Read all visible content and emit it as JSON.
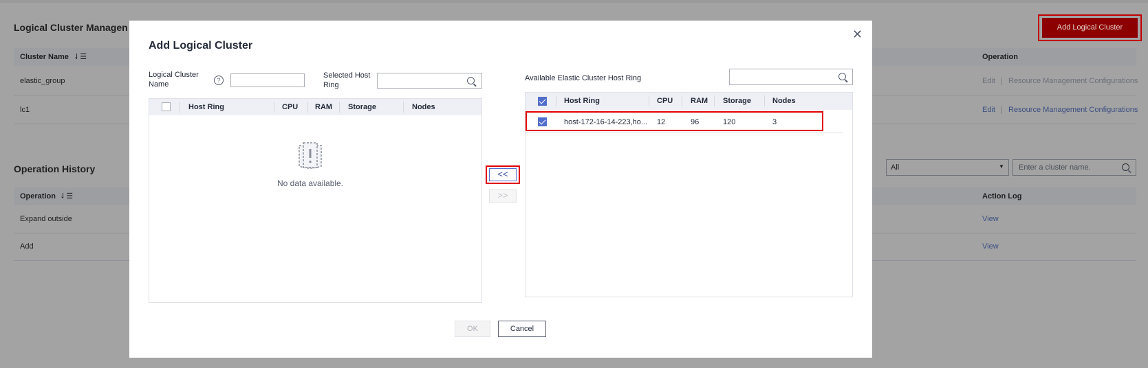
{
  "background": {
    "section1_title": "Logical Cluster Managen",
    "add_button_label": "Add Logical Cluster",
    "table1": {
      "col_cluster_name": "Cluster Name",
      "col_operation": "Operation",
      "rows": [
        {
          "name": "elastic_group",
          "edit": "Edit",
          "rmc": "Resource Management Configurations"
        },
        {
          "name": "lc1",
          "edit": "Edit",
          "rmc": "Resource Management Configurations"
        }
      ]
    },
    "section2_title": "Operation History",
    "filter_select": "All",
    "filter_search_placeholder": "Enter a cluster name.",
    "table2": {
      "col_operation": "Operation",
      "col_action_log": "Action Log",
      "rows": [
        {
          "operation": "Expand outside",
          "view": "View"
        },
        {
          "operation": "Add",
          "view": "View"
        }
      ]
    }
  },
  "modal": {
    "title": "Add Logical Cluster",
    "name_label_line1": "Logical Cluster",
    "name_label_line2": "Name",
    "name_value": "",
    "selected_label_line1": "Selected Host",
    "selected_label_line2": "Ring",
    "selected_search_value": "",
    "available_label": "Available Elastic Cluster Host Ring",
    "available_search_value": "",
    "left_table": {
      "headers": [
        "Host Ring",
        "CPU",
        "RAM",
        "Storage",
        "Nodes"
      ],
      "empty_text": "No data available."
    },
    "right_table": {
      "headers": [
        "Host Ring",
        "CPU",
        "RAM",
        "Storage",
        "Nodes"
      ],
      "rows": [
        {
          "host_ring": "host-172-16-14-223,ho...",
          "cpu": "12",
          "ram": "96",
          "storage": "120",
          "nodes": "3",
          "checked": true
        }
      ]
    },
    "move_left_label": "<<",
    "move_right_label": ">>",
    "ok_label": "OK",
    "cancel_label": "Cancel"
  }
}
